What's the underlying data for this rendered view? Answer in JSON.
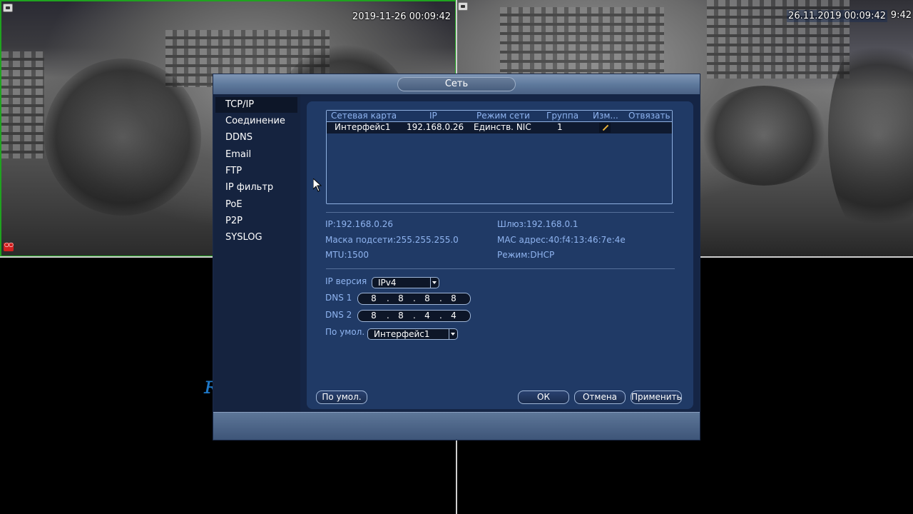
{
  "cameras": {
    "cam1_timestamp": "2019-11-26 00:09:42",
    "cam2_timestamp": "26.11.2019 00:09:42",
    "cam2_timestamp_tail": "9:42"
  },
  "dialog": {
    "title": "Сеть",
    "sidebar": {
      "items": [
        {
          "label": "TCP/IP",
          "active": true
        },
        {
          "label": "Соединение"
        },
        {
          "label": "DDNS"
        },
        {
          "label": "Email"
        },
        {
          "label": "FTP"
        },
        {
          "label": "IP фильтр"
        },
        {
          "label": "PoE"
        },
        {
          "label": "P2P"
        },
        {
          "label": "SYSLOG"
        }
      ]
    },
    "table": {
      "headers": [
        "Сетевая карта",
        "IP",
        "Режим сети",
        "Группа",
        "Изм...",
        "Отвязать"
      ],
      "rows": [
        {
          "nic": "Интерфейс1",
          "ip": "192.168.0.26",
          "mode": "Единств. NIC",
          "group": "1"
        }
      ]
    },
    "info": {
      "ip": "IP:192.168.0.26",
      "gateway": "Шлюз:192.168.0.1",
      "mask": "Маска подсети:255.255.255.0",
      "mac": "MAC адрес:40:f4:13:46:7e:4e",
      "mtu": "MTU:1500",
      "mode": "Режим:DHCP"
    },
    "form": {
      "ip_version_label": "IP версия",
      "ip_version_value": "IPv4",
      "dns1_label": "DNS 1",
      "dns1": [
        "8",
        "8",
        "8",
        "8"
      ],
      "dns2_label": "DNS 2",
      "dns2": [
        "8",
        "8",
        "4",
        "4"
      ],
      "default_label": "По умол.",
      "default_value": "Интерфейс1"
    },
    "buttons": {
      "default": "По умол.",
      "ok": "ОК",
      "cancel": "Отмена",
      "apply": "Применить"
    }
  }
}
